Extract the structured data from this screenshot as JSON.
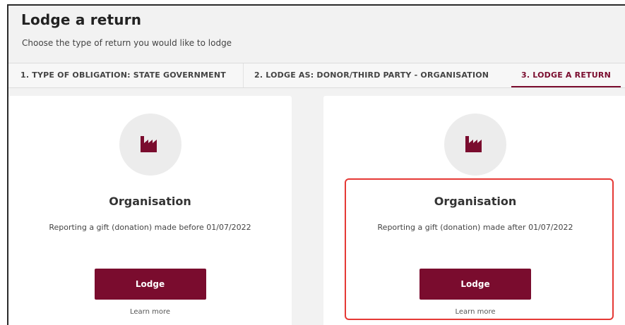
{
  "header": {
    "title": "Lodge a return",
    "subtitle": "Choose the type of return you would like to lodge"
  },
  "tabs": [
    {
      "label": "1. TYPE OF OBLIGATION: STATE GOVERNMENT",
      "active": false
    },
    {
      "label": "2. LODGE AS: DONOR/THIRD PARTY - ORGANISATION",
      "active": false
    },
    {
      "label": "3. LODGE A RETURN",
      "active": true
    }
  ],
  "cards": [
    {
      "icon": "factory-icon",
      "title": "Organisation",
      "description": "Reporting a gift (donation) made before 01/07/2022",
      "button_label": "Lodge",
      "link_label": "Learn more",
      "highlighted": false
    },
    {
      "icon": "factory-icon",
      "title": "Organisation",
      "description": "Reporting a gift (donation) made after 01/07/2022",
      "button_label": "Lodge",
      "link_label": "Learn more",
      "highlighted": true
    }
  ],
  "colors": {
    "brand": "#7a0c2e",
    "background": "#f2f2f2",
    "highlight": "#e53935"
  }
}
